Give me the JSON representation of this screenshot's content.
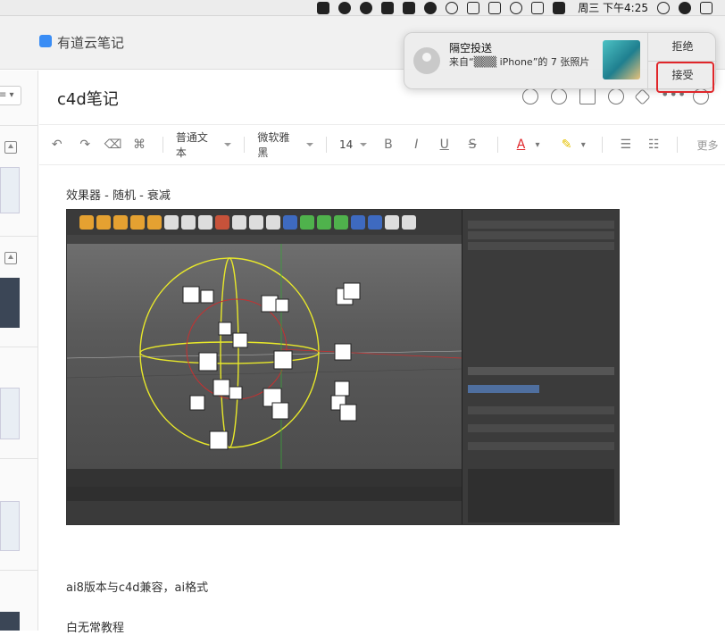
{
  "menubar": {
    "time": "周三 下午4:25"
  },
  "app": {
    "name": "有道云笔记"
  },
  "document": {
    "title": "c4d笔记",
    "lines": [
      "效果器 - 随机 - 衰减",
      "ai8版本与c4d兼容，ai格式",
      "白无常教程"
    ]
  },
  "toolbar": {
    "paragraph_style": "普通文本",
    "font_family": "微软雅黑",
    "font_size": "14",
    "bold": "B",
    "italic": "I",
    "underline": "U",
    "strike": "S",
    "font_color": "A",
    "more": "更多"
  },
  "notification": {
    "title": "隔空投送",
    "body": "来自“▒▒▒ iPhone”的 7 张照片",
    "decline_label": "拒绝",
    "accept_label": "接受"
  },
  "colors": {
    "accent_blue": "#3a8df5",
    "highlight_red": "#e0262a"
  }
}
